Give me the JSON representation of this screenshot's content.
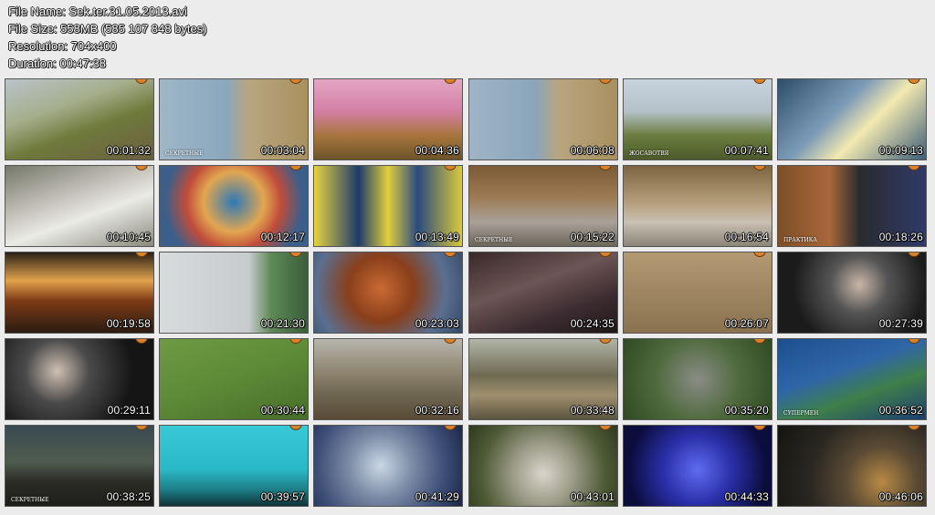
{
  "file_info": {
    "file_name": "File Name: Sek.ter.31.05.2013.avi",
    "file_size": "File Size: 558MB (585 107 848 bytes)",
    "resolution": "Resolution: 704x400",
    "duration": "Duration: 00:47:38"
  },
  "thumbnails": [
    {
      "timestamp": "00:01:32",
      "bg": "linear-gradient(160deg,#b9c3c9 0%,#a6ae8c 35%,#6f7a3c 60%,#6b6040 100%)"
    },
    {
      "timestamp": "00:03:04",
      "caption": "СЕКРЕТНЫЕ",
      "bg": "linear-gradient(90deg,#9eb6c8 0%,#8aa7bd 45%,#b9a57f 60%,#a8905f 100%)"
    },
    {
      "timestamp": "00:04:36",
      "bg": "linear-gradient(180deg,#e4a6c1 0%,#d37fa3 40%,#a8763e 70%,#6c5428 100%)"
    },
    {
      "timestamp": "00:06:08",
      "bg": "linear-gradient(90deg,#9fb5c6 0%,#8aa5bb 45%,#b9a57f 60%,#a8905f 100%)"
    },
    {
      "timestamp": "00:07:41",
      "caption": "ЖОСАВОТВЯ",
      "bg": "linear-gradient(180deg,#c7d4de 0%,#b4c1c9 40%,#6a7d3e 70%,#4d5b2c 100%)"
    },
    {
      "timestamp": "00:09:13",
      "bg": "linear-gradient(135deg,#2d4e6a 0%,#7c9bb6 40%,#f3e9b1 60%,#3c5d79 100%)"
    },
    {
      "timestamp": "00:10:45",
      "bg": "linear-gradient(160deg,#75776a 0%,#c6c3bb 40%,#eaeae7 60%,#8b8a7c 100%)"
    },
    {
      "timestamp": "00:12:17",
      "bg": "radial-gradient(circle at 50% 45%,#2e79b6 0%,#e2a650 35%,#c04c3a 55%,#3b5f8a 80%)"
    },
    {
      "timestamp": "00:13:49",
      "bg": "linear-gradient(90deg,#e6d33f 0%,#1d3b6b 30%,#e0cf3e 50%,#2a4a80 70%,#d9c93a 100%)"
    },
    {
      "timestamp": "00:15:22",
      "caption": "СЕКРЕТНЫЕ",
      "bg": "linear-gradient(180deg,#7b5a36 0%,#9d7c55 40%,#a9a199 70%,#6c655a 100%)"
    },
    {
      "timestamp": "00:16:54",
      "bg": "linear-gradient(180deg,#7e6542 0%,#b49d7a 45%,#c9c0b2 70%,#8b8478 100%)"
    },
    {
      "timestamp": "00:18:26",
      "caption": "ПРАКТИКА",
      "bg": "linear-gradient(90deg,#7d4f28 0%,#a9673a 35%,#2a2b2f 55%,#2f3a68 100%)"
    },
    {
      "timestamp": "00:19:58",
      "bg": "linear-gradient(180deg,#2a2017 0%,#e2a34d 35%,#7e3b16 60%,#2b1b10 100%)"
    },
    {
      "timestamp": "00:21:30",
      "bg": "linear-gradient(90deg,#d8dbdc 0%,#c7cbcd 60%,#5f8a57 75%,#3b5d3a 100%)"
    },
    {
      "timestamp": "00:23:03",
      "bg": "radial-gradient(circle at 45% 45%,#c96a34 0%,#8a3f1a 35%,#5b6f90 70%,#344866 100%)"
    },
    {
      "timestamp": "00:24:35",
      "bg": "linear-gradient(160deg,#3a2a2a 0%,#6c5555 40%,#3d2d32 70%,#1f1717 100%)"
    },
    {
      "timestamp": "00:26:07",
      "bg": "linear-gradient(180deg,#b39a73 0%,#9f8662 50%,#8a7250 100%)"
    },
    {
      "timestamp": "00:27:39",
      "bg": "radial-gradient(circle at 55% 40%,#c8b6a8 0%,#555 30%,#1b1b1b 70%)"
    },
    {
      "timestamp": "00:29:11",
      "bg": "radial-gradient(circle at 35% 40%,#d0bfb2 0%,#4a4a4a 30%,#151515 70%)"
    },
    {
      "timestamp": "00:30:44",
      "bg": "linear-gradient(160deg,#6f9a44 0%,#5d8a36 50%,#476e2a 100%)"
    },
    {
      "timestamp": "00:32:16",
      "bg": "linear-gradient(180deg,#b7b6ad 0%,#8b806b 45%,#6e6550 70%,#584a36 100%)"
    },
    {
      "timestamp": "00:33:48",
      "bg": "linear-gradient(180deg,#b1b5a7 0%,#6f6a52 45%,#9f8f6e 70%,#5c5440 100%)"
    },
    {
      "timestamp": "00:35:20",
      "bg": "radial-gradient(circle at 50% 50%,#8a8c86 0%,#4f6a3d 50%,#2f4a22 100%)"
    },
    {
      "timestamp": "00:36:52",
      "caption": "СУПЕРМЕН",
      "bg": "linear-gradient(160deg,#1d4f8f 0%,#2e66a8 40%,#3f7f4a 65%,#1b3f6f 100%)"
    },
    {
      "timestamp": "00:38:25",
      "caption": "СЕКРЕТНЫЕ",
      "bg": "linear-gradient(180deg,#3a4a52 0%,#4f5c4f 45%,#2c2c27 70%,#1d1d1a 100%)"
    },
    {
      "timestamp": "00:39:57",
      "bg": "linear-gradient(180deg,#37c9d6 0%,#2ab8c6 55%,#1d7d86 80%,#0f3338 100%)"
    },
    {
      "timestamp": "00:41:29",
      "bg": "radial-gradient(circle at 45% 50%,#cbd7e6 0%,#7c8ba6 35%,#3e4f77 70%,#1c2747 100%)"
    },
    {
      "timestamp": "00:43:01",
      "bg": "radial-gradient(circle at 50% 60%,#d9d5cc 0%,#9a9a86 35%,#4f5a36 70%,#2f3a1f 100%)"
    },
    {
      "timestamp": "00:44:33",
      "bg": "radial-gradient(circle at 50% 55%,#5f6cf0 0%,#2a2fa8 40%,#0b0d3d 80%)"
    },
    {
      "timestamp": "00:46:06",
      "bg": "radial-gradient(circle at 70% 70%,#b88a44 0%,#5a4a34 30%,#2b2822 60%,#141412 100%)"
    }
  ],
  "colors": {
    "badge": "#d9822b",
    "background": "#ececec"
  }
}
